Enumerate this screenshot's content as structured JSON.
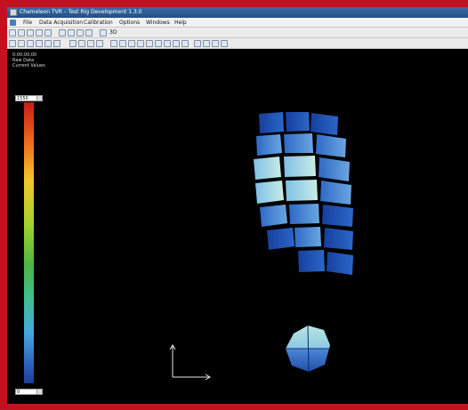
{
  "window": {
    "title": "Chameleon TVR – Test Rig Development 1.3.0"
  },
  "menu": {
    "items": [
      "File",
      "Data Acquisition",
      "Calibration",
      "Options",
      "Windows",
      "Help"
    ]
  },
  "toolbar": {
    "mode_label": "3D"
  },
  "viewport": {
    "time": "0:00:00.00",
    "data_mode": "Raw Data",
    "display_mode": "Current Values",
    "colorbar_max": "1550",
    "colorbar_min": "0"
  },
  "colors": {
    "background": "#000000",
    "frame": "#c4111f",
    "sensor_dark": "#1f56b8",
    "sensor_mid": "#4d8fd8",
    "sensor_light": "#b7e4e6"
  },
  "icons": {
    "axes": "axes-icon",
    "toolbar": [
      "open-icon",
      "save-icon",
      "print-icon",
      "settings-icon",
      "grid-icon"
    ]
  }
}
